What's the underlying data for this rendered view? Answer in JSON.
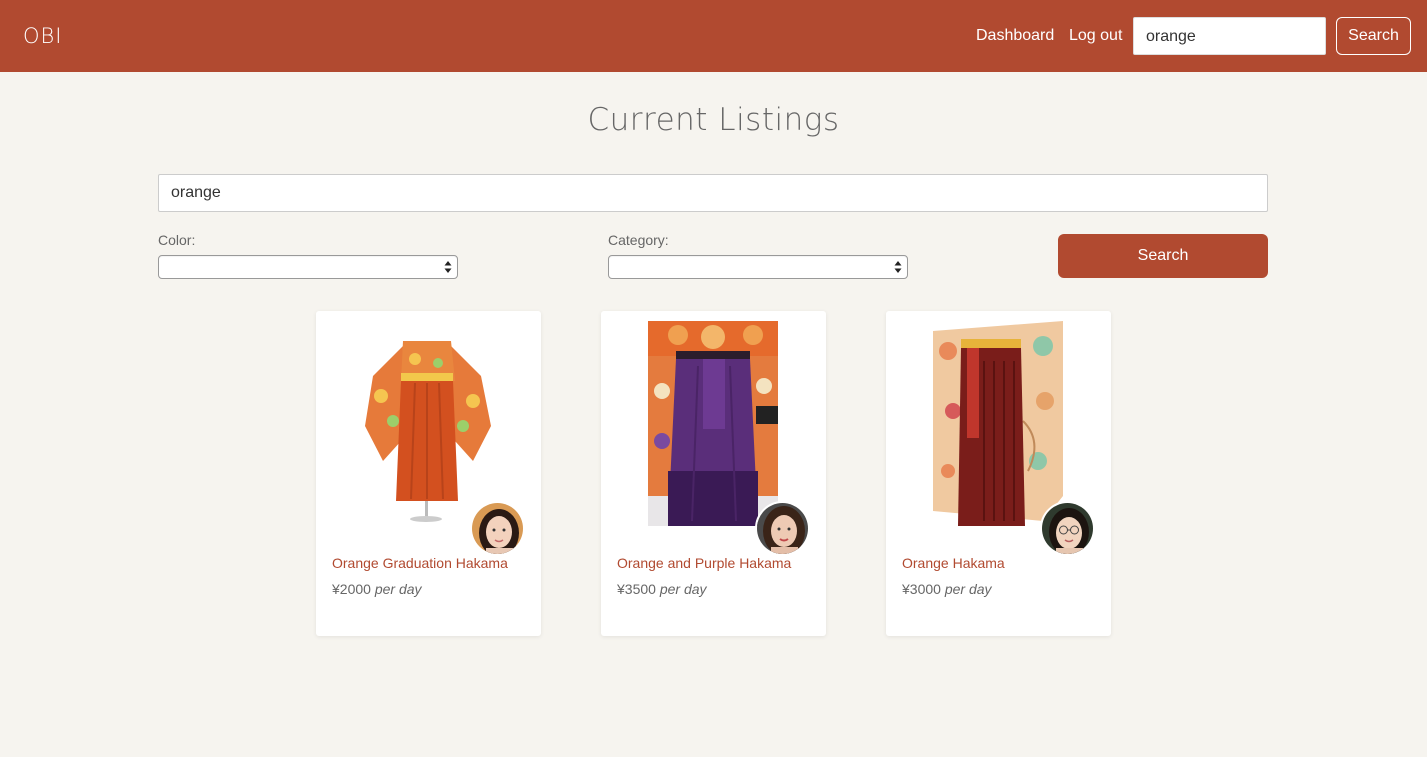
{
  "navbar": {
    "brand": "OBI",
    "links": {
      "dashboard": "Dashboard",
      "logout": "Log out"
    },
    "search_value": "orange",
    "search_button": "Search",
    "background": "#b14a30"
  },
  "page": {
    "title": "Current Listings"
  },
  "filters": {
    "search_value": "orange",
    "color_label": "Color:",
    "color_value": "",
    "category_label": "Category:",
    "category_value": "",
    "search_button": "Search"
  },
  "listings": [
    {
      "title": "Orange Graduation Hakama",
      "price": "¥2000",
      "price_unit": "per day",
      "image_icon": "kimono-photo-icon",
      "avatar_icon": "owner-avatar-icon"
    },
    {
      "title": "Orange and Purple Hakama",
      "price": "¥3500",
      "price_unit": "per day",
      "image_icon": "kimono-photo-icon",
      "avatar_icon": "owner-avatar-icon"
    },
    {
      "title": "Orange Hakama",
      "price": "¥3000",
      "price_unit": "per day",
      "image_icon": "kimono-photo-icon",
      "avatar_icon": "owner-avatar-icon"
    }
  ],
  "colors": {
    "accent": "#b14a30",
    "background": "#f6f4ef"
  }
}
